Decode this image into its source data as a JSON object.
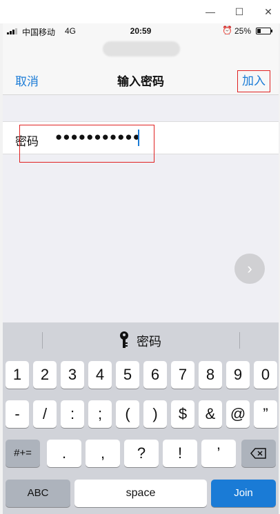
{
  "window": {
    "min_icon": "minimize-icon",
    "max_icon": "maximize-icon",
    "close_icon": "close-icon"
  },
  "status_bar": {
    "carrier": "中国移动",
    "network": "4G",
    "time": "20:59",
    "battery": "25%",
    "battery_level": 0.25
  },
  "nav": {
    "cancel": "取消",
    "title": "输入密码",
    "join": "加入"
  },
  "password": {
    "label": "密码",
    "value": "●●●●●●●●●●●"
  },
  "keyboard_hint": {
    "icon": "key-icon",
    "text": "密码"
  },
  "keyboard": {
    "row1": [
      "1",
      "2",
      "3",
      "4",
      "5",
      "6",
      "7",
      "8",
      "9",
      "0"
    ],
    "row2": [
      "-",
      "/",
      ":",
      ";",
      "(",
      ")",
      "$",
      "&",
      "@",
      "”"
    ],
    "row3": [
      ".",
      ",",
      "?",
      "!",
      "’"
    ],
    "symbols_key": "#+=",
    "abc_key": "ABC",
    "space_key": "space",
    "join_key": "Join"
  },
  "colors": {
    "accent": "#1a7bd6",
    "highlight_border": "#e02020"
  }
}
